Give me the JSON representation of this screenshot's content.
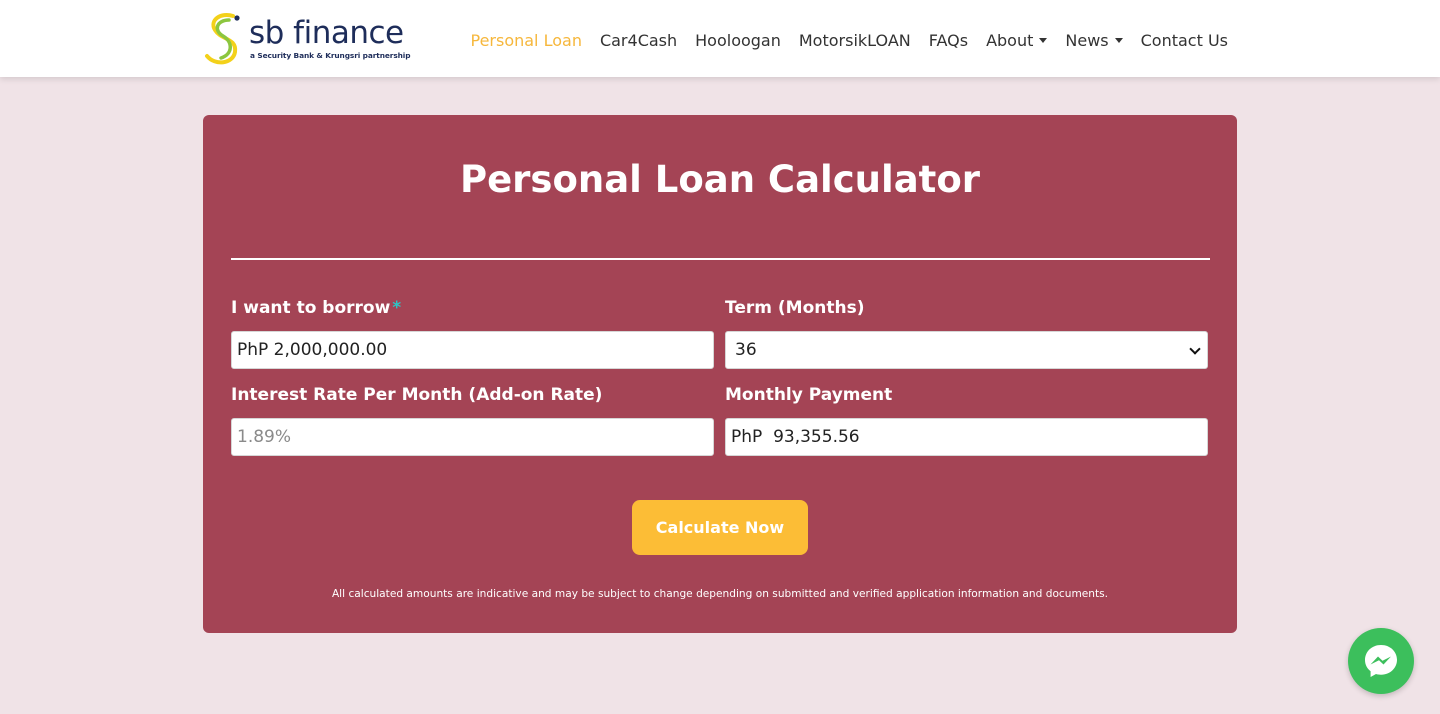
{
  "brand": {
    "name": "sb finance",
    "tagline": "a Security Bank & Krungsri partnership"
  },
  "nav": {
    "items": [
      {
        "label": "Personal Loan",
        "active": true
      },
      {
        "label": "Car4Cash"
      },
      {
        "label": "Hooloogan"
      },
      {
        "label": "MotorsikLOAN"
      },
      {
        "label": "FAQs"
      },
      {
        "label": "About",
        "dropdown": true
      },
      {
        "label": "News",
        "dropdown": true
      },
      {
        "label": "Contact Us"
      }
    ]
  },
  "calculator": {
    "title": "Personal Loan Calculator",
    "borrow": {
      "label": "I want to borrow",
      "required_mark": "*",
      "value": "PhP 2,000,000.00"
    },
    "term": {
      "label": "Term (Months)",
      "value": "36"
    },
    "interest": {
      "label": "Interest Rate Per Month (Add-on Rate)",
      "placeholder": "1.89%"
    },
    "monthly": {
      "label": "Monthly Payment",
      "value": "PhP  93,355.56"
    },
    "button_label": "Calculate Now",
    "disclaimer": "All calculated amounts are indicative and may be subject to change depending on submitted and verified application information and documents."
  },
  "colors": {
    "card": "#a44455",
    "background": "#f0e3e7",
    "accent": "#fcbd36",
    "nav_active": "#f6b73c",
    "messenger": "#3cbf5c"
  },
  "icons": {
    "brand_logo": "sb-finance-logo-icon",
    "messenger": "messenger-icon"
  }
}
